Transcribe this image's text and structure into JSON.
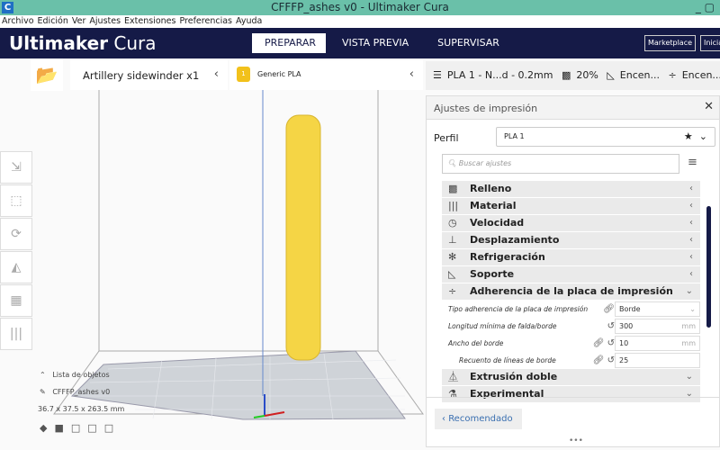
{
  "window": {
    "title": "CFFFP_ashes v0 - Ultimaker Cura",
    "app_icon": "C"
  },
  "menu": [
    "Archivo",
    "Edición",
    "Ver",
    "Ajustes",
    "Extensiones",
    "Preferencias",
    "Ayuda"
  ],
  "header": {
    "brand_bold": "Ultimaker",
    "brand_light": "Cura",
    "tabs": [
      "PREPARAR",
      "VISTA PREVIA",
      "SUPERVISAR"
    ],
    "marketplace": "Marketplace",
    "signin": "Iniciar"
  },
  "stage": {
    "printer": "Artillery sidewinder x1",
    "material": "Generic PLA",
    "extruder_no": "1",
    "profile": "PLA 1 - N...d - 0.2mm",
    "infill": "20%",
    "support": "Encen...",
    "adhesion": "Encen..."
  },
  "objects": {
    "toggle": "Lista de objetos",
    "name": "CFFFP_ashes v0",
    "dims": "36.7 x 37.5 x 263.5 mm"
  },
  "panel": {
    "title": "Ajustes de impresión",
    "profile_label": "Perfil",
    "profile_value": "PLA 1",
    "search_placeholder": "Buscar ajustes",
    "categories": [
      "Relleno",
      "Material",
      "Velocidad",
      "Desplazamiento",
      "Refrigeración",
      "Soporte",
      "Adherencia de la placa de impresión",
      "Extrusión doble",
      "Experimental"
    ],
    "settings": [
      {
        "label": "Tipo adherencia de la placa de impresión",
        "value": "Borde",
        "unit": ""
      },
      {
        "label": "Longitud mínima de falda/borde",
        "value": "300",
        "unit": "mm"
      },
      {
        "label": "Ancho del borde",
        "value": "10",
        "unit": "mm"
      },
      {
        "label": "Recuento de líneas de borde",
        "value": "25",
        "unit": ""
      }
    ],
    "recommended": "Recomendado"
  },
  "colors": {
    "header": "#151a47",
    "titlebar": "#6ac0a9",
    "model": "#f5d545"
  }
}
